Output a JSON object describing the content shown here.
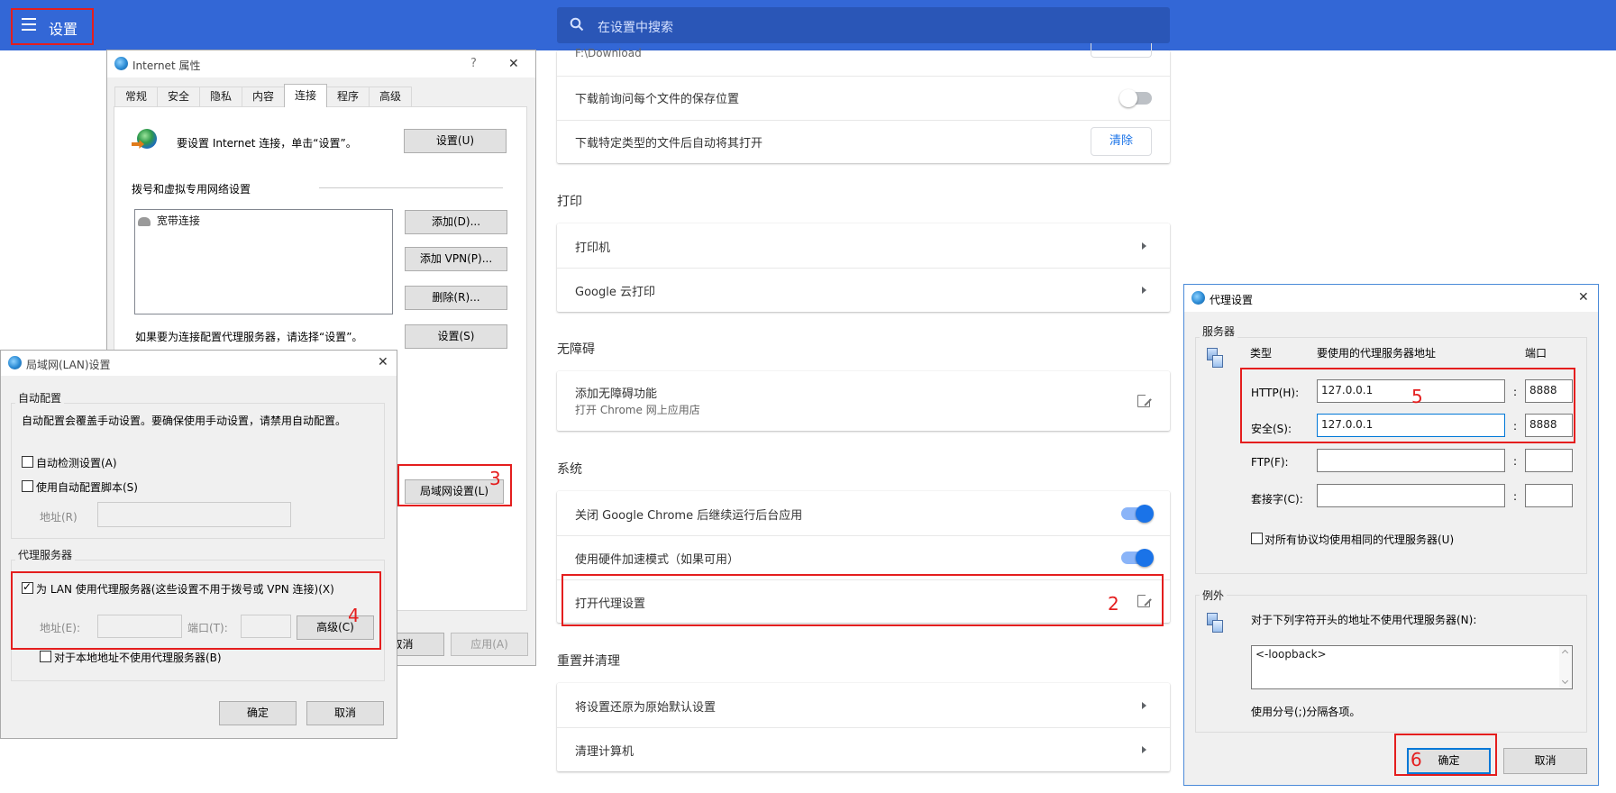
{
  "topbar": {
    "title": "设置",
    "search_placeholder": "在设置中搜索"
  },
  "downloads": {
    "path_value": "F:\\Download",
    "ask_location_label": "下载前询问每个文件的保存位置",
    "auto_open_label": "下载特定类型的文件后自动将其打开",
    "clear_label": "清除"
  },
  "print": {
    "section": "打印",
    "printer_label": "打印机",
    "cloud_print_label": "Google 云打印"
  },
  "accessibility": {
    "section": "无障碍",
    "add_label": "添加无障碍功能",
    "add_sub": "打开 Chrome 网上应用店"
  },
  "system": {
    "section": "系统",
    "bg_apps_label": "关闭 Google Chrome 后继续运行后台应用",
    "hw_accel_label": "使用硬件加速模式（如果可用）",
    "proxy_label": "打开代理设置"
  },
  "reset": {
    "section": "重置并清理",
    "restore_label": "将设置还原为原始默认设置",
    "cleanup_label": "清理计算机"
  },
  "inet": {
    "title": "Internet 属性",
    "help": "?",
    "close": "✕",
    "tabs": [
      "常规",
      "安全",
      "隐私",
      "内容",
      "连接",
      "程序",
      "高级"
    ],
    "setup_text": "要设置 Internet 连接，单击“设置”。",
    "setup_btn": "设置(U)",
    "dialup_group": "拨号和虚拟专用网络设置",
    "list_item": "宽带连接",
    "add_btn": "添加(D)...",
    "add_vpn_btn": "添加 VPN(P)...",
    "delete_btn": "删除(R)...",
    "proxy_note": "如果要为连接配置代理服务器，请选择“设置”。",
    "settings_btn": "设置(S)",
    "lan_btn": "局域网设置(L)",
    "cancel_btn": "取消",
    "apply_btn": "应用(A)"
  },
  "lan": {
    "title": "局域网(LAN)设置",
    "close": "✕",
    "auto_group": "自动配置",
    "auto_note": "自动配置会覆盖手动设置。要确保使用手动设置，请禁用自动配置。",
    "auto_detect": "自动检测设置(A)",
    "auto_script": "使用自动配置脚本(S)",
    "address_label": "地址(R)",
    "proxy_group": "代理服务器",
    "use_proxy": "为 LAN 使用代理服务器(这些设置不用于拨号或 VPN 连接)(X)",
    "addr_label": "地址(E):",
    "port_label": "端口(T):",
    "advanced_btn": "高级(C)",
    "bypass_local": "对于本地地址不使用代理服务器(B)",
    "ok_btn": "确定",
    "cancel_btn": "取消"
  },
  "proxy": {
    "title": "代理设置",
    "close": "✕",
    "servers_group": "服务器",
    "col_type": "类型",
    "col_addr": "要使用的代理服务器地址",
    "col_port": "端口",
    "http_label": "HTTP(H):",
    "http_addr": "127.0.0.1",
    "http_port": "8888",
    "secure_label": "安全(S):",
    "secure_addr": "127.0.0.1",
    "secure_port": "8888",
    "ftp_label": "FTP(F):",
    "socks_label": "套接字(C):",
    "colon": ":",
    "same_proxy": "对所有协议均使用相同的代理服务器(U)",
    "exceptions_group": "例外",
    "exceptions_note": "对于下列字符开头的地址不使用代理服务器(N):",
    "exceptions_value": "<-loopback>",
    "semicolon_note": "使用分号(;)分隔各项。",
    "ok_btn": "确定",
    "cancel_btn": "取消"
  },
  "annotations": [
    "2",
    "3",
    "4",
    "5",
    "6"
  ]
}
